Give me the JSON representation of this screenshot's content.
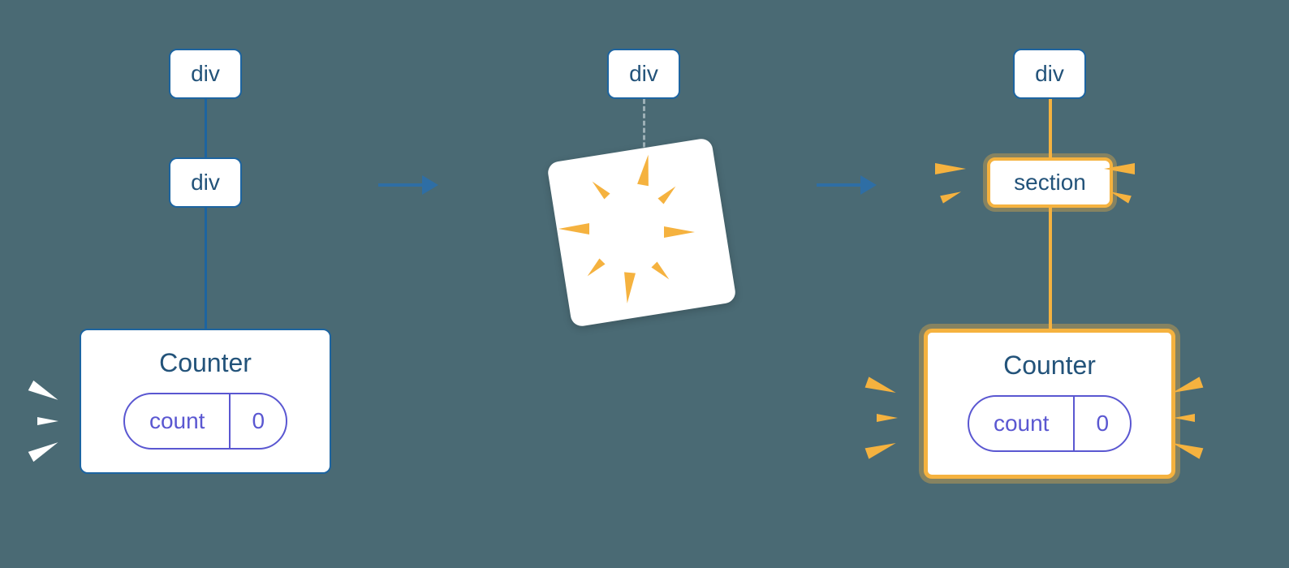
{
  "stages": {
    "left": {
      "top_node": "div",
      "mid_node": "div",
      "counter": {
        "title": "Counter",
        "state_label": "count",
        "state_value": "0"
      }
    },
    "center": {
      "top_node": "div"
    },
    "right": {
      "top_node": "div",
      "mid_node": "section",
      "counter": {
        "title": "Counter",
        "state_label": "count",
        "state_value": "0"
      }
    }
  },
  "colors": {
    "bg": "#4a6a74",
    "blue": "#1d64a0",
    "blue_text": "#23537a",
    "purple": "#5a57d1",
    "gold": "#f5b23f"
  }
}
